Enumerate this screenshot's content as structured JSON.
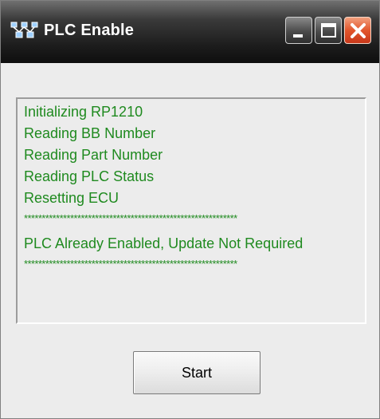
{
  "window": {
    "title": "PLC Enable",
    "controls": {
      "minimize": "minimize",
      "maximize": "maximize",
      "close": "close"
    }
  },
  "log": {
    "lines": [
      "Initializing RP1210",
      "Reading BB Number",
      "Reading Part Number",
      "Reading PLC Status",
      "Resetting ECU",
      "************************************************************",
      "PLC Already Enabled, Update Not Required",
      "************************************************************"
    ],
    "text_color": "#1f8a1f"
  },
  "buttons": {
    "start_label": "Start"
  },
  "icons": {
    "app": "network-plc-icon",
    "minimize": "minimize-icon",
    "maximize": "maximize-icon",
    "close": "close-icon"
  },
  "colors": {
    "titlebar": "#1e1e1e",
    "close_button": "#e2562c",
    "background": "#ececec"
  }
}
